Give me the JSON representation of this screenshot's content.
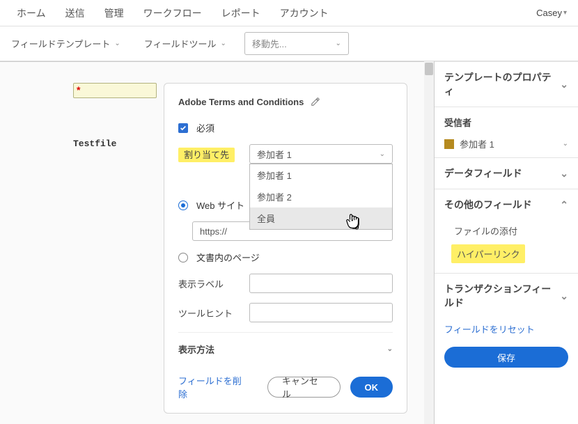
{
  "nav": {
    "items": [
      "ホーム",
      "送信",
      "管理",
      "ワークフロー",
      "レポート",
      "アカウント"
    ],
    "user": "Casey"
  },
  "toolbar": {
    "field_template": "フィールドテンプレート",
    "field_tool": "フィールドツール",
    "move_to": "移動先..."
  },
  "canvas": {
    "testfile": "Testfile"
  },
  "popover": {
    "title": "Adobe Terms and Conditions",
    "required_label": "必須",
    "assign_label": "割り当て先",
    "assign_selected": "参加者 1",
    "assign_options": [
      "参加者 1",
      "参加者 2",
      "全員"
    ],
    "radio_website": "Web サイト",
    "radio_docpage": "文書内のページ",
    "url_value": "https://",
    "display_label": "表示ラベル",
    "tooltip_label": "ツールヒント",
    "display_method": "表示方法",
    "delete_field": "フィールドを削除",
    "cancel": "キャンセル",
    "ok": "OK"
  },
  "rpanel": {
    "template_props": "テンプレートのプロパティ",
    "recipients": "受信者",
    "participant1": "参加者 1",
    "data_fields": "データフィールド",
    "other_fields": "その他のフィールド",
    "file_attach": "ファイルの添付",
    "hyperlink": "ハイパーリンク",
    "transaction_fields": "トランザクションフィールド",
    "reset_fields": "フィールドをリセット",
    "save": "保存"
  }
}
